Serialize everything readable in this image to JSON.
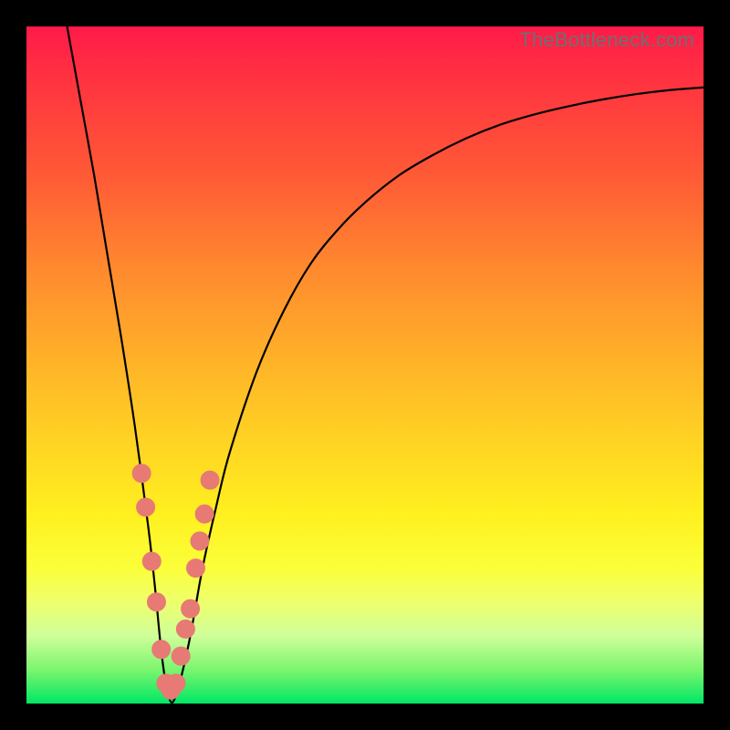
{
  "watermark": "TheBottleneck.com",
  "colors": {
    "curve_stroke": "#000000",
    "curve_width": 2.2,
    "marker_fill": "#e77a74",
    "marker_stroke": "#e77a74",
    "marker_radius": 10
  },
  "chart_data": {
    "type": "line",
    "title": "",
    "xlabel": "",
    "ylabel": "",
    "xlim": [
      0,
      100
    ],
    "ylim": [
      0,
      100
    ],
    "series": [
      {
        "name": "bottleneck-curve",
        "x": [
          6,
          8,
          10,
          12,
          14,
          16,
          18,
          19,
          20,
          21,
          22,
          24,
          26,
          28,
          30,
          34,
          38,
          42,
          46,
          50,
          55,
          60,
          65,
          70,
          75,
          80,
          85,
          90,
          95,
          100
        ],
        "y": [
          100,
          89,
          78,
          66,
          54,
          41,
          26,
          17,
          7,
          1,
          1,
          9,
          20,
          29,
          37,
          49,
          58,
          65,
          70,
          74,
          78,
          81,
          83.5,
          85.5,
          87,
          88.2,
          89.2,
          90,
          90.6,
          91
        ]
      }
    ],
    "markers_on_curve": [
      {
        "x": 17.0,
        "y": 34
      },
      {
        "x": 17.6,
        "y": 29
      },
      {
        "x": 18.5,
        "y": 21
      },
      {
        "x": 19.2,
        "y": 15
      },
      {
        "x": 19.9,
        "y": 8
      },
      {
        "x": 20.6,
        "y": 3
      },
      {
        "x": 21.3,
        "y": 2
      },
      {
        "x": 22.1,
        "y": 3
      },
      {
        "x": 22.8,
        "y": 7
      },
      {
        "x": 23.5,
        "y": 11
      },
      {
        "x": 24.2,
        "y": 14
      },
      {
        "x": 25.0,
        "y": 20
      },
      {
        "x": 25.6,
        "y": 24
      },
      {
        "x": 26.3,
        "y": 28
      },
      {
        "x": 27.1,
        "y": 33
      }
    ]
  }
}
